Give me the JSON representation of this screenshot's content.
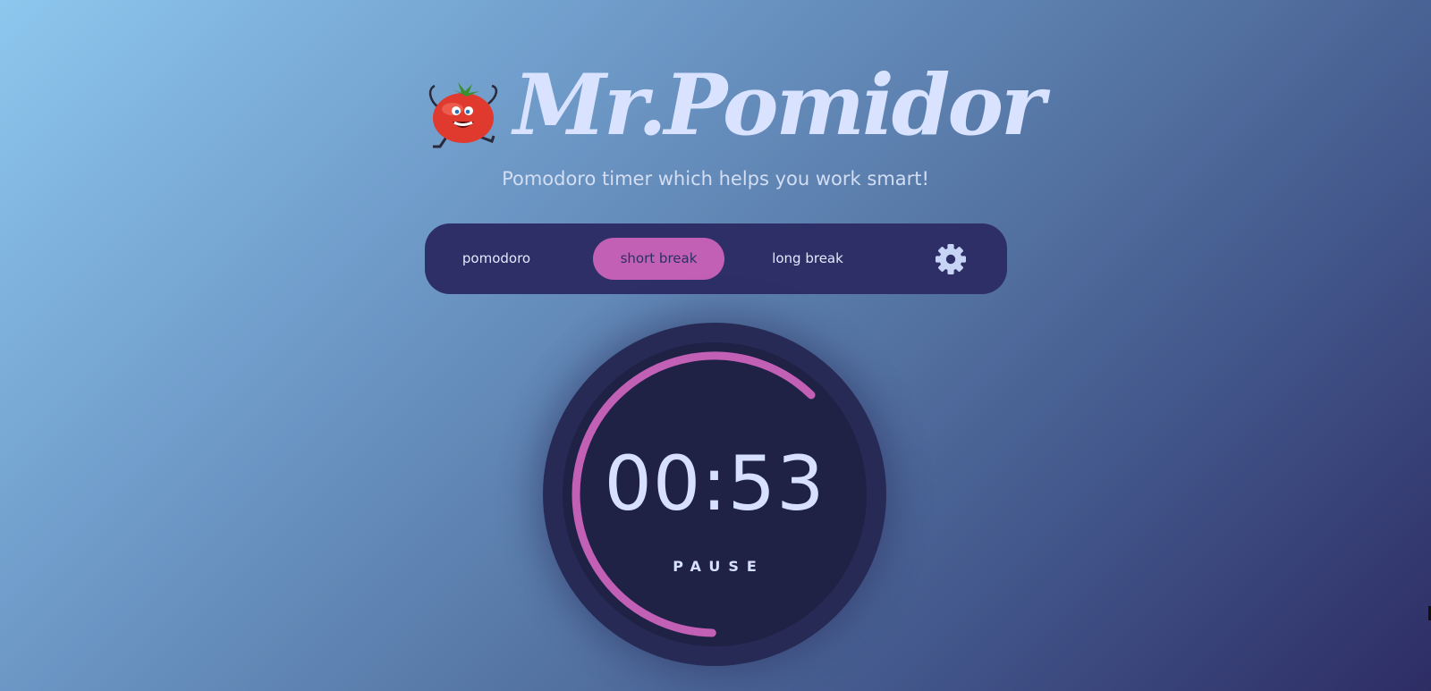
{
  "header": {
    "brand": "Mr.Pomidor",
    "tagline": "Pomodoro timer which helps you work smart!",
    "logo_icon": "tomato-mascot-icon"
  },
  "modes": {
    "items": [
      {
        "label": "pomodoro",
        "active": false
      },
      {
        "label": "short break",
        "active": true
      },
      {
        "label": "long break",
        "active": false
      }
    ],
    "settings_icon": "gear-icon"
  },
  "timer": {
    "time": "00:53",
    "action_label": "PAUSE",
    "progress_fraction": 0.62
  },
  "colors": {
    "accent": "#c260b6",
    "panel": "#2e2f66",
    "dial_outer": "#262a55",
    "dial_inner": "#1f2145",
    "text_light": "#d7e1ff"
  }
}
